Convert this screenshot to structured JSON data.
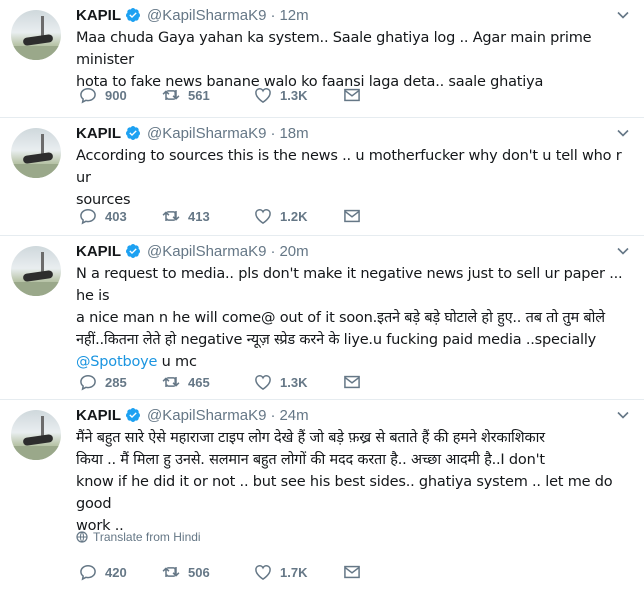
{
  "tweets": [
    {
      "name": "KAPIL",
      "handle": "@KapilSharmaK9",
      "time": "12m",
      "lines": [
        "Maa chuda Gaya yahan ka system.. Saale ghatiya log .. Agar main prime minister",
        "hota to fake news banane walo ko faansi laga deta.. saale ghatiya"
      ],
      "replies": "900",
      "retweets": "561",
      "likes": "1.3K"
    },
    {
      "name": "KAPIL",
      "handle": "@KapilSharmaK9",
      "time": "18m",
      "lines": [
        "According to sources this is the news .. u motherfucker why don't u tell who r ur",
        "sources"
      ],
      "replies": "403",
      "retweets": "413",
      "likes": "1.2K"
    },
    {
      "name": "KAPIL",
      "handle": "@KapilSharmaK9",
      "time": "20m",
      "lines": [
        "N a request to media.. pls don't make it negative news just to sell ur paper ... he is",
        "a nice man n he will come@ out of it soon.इतने बड़े बड़े घोटाले हो हुए.. तब तो तुम बोले",
        "नहीं..कितना लेते हो negative न्यूज़ स्प्रेड करने के liye.u fucking paid media ..specially"
      ],
      "mention": "@Spotboye",
      "mention_tail": " u mc",
      "replies": "285",
      "retweets": "465",
      "likes": "1.3K"
    },
    {
      "name": "KAPIL",
      "handle": "@KapilSharmaK9",
      "time": "24m",
      "lines": [
        "मैंने बहुत सारे ऐसे महाराजा टाइप लोग देखे हैं जो बड़े फ़ख्र से बताते हैं की हमने शेरकाशिकार",
        "किया .. मैं मिला हु उनसे. सलमान बहुत लोगों की मदद करता है.. अच्छा आदमी है..I don't",
        "know if he did it or not .. but see his best sides.. ghatiya system .. let me do good",
        "work .."
      ],
      "translate": "Translate from Hindi",
      "replies": "420",
      "retweets": "506",
      "likes": "1.7K"
    }
  ],
  "colors": {
    "verified": "#1da1f2",
    "muted": "#657786",
    "link": "#1b95e0"
  },
  "icons": {
    "reply": "reply-icon",
    "retweet": "retweet-icon",
    "like": "heart-icon",
    "dm": "envelope-icon",
    "caret": "chevron-down-icon",
    "verified": "verified-badge-icon",
    "translate": "globe-icon"
  }
}
